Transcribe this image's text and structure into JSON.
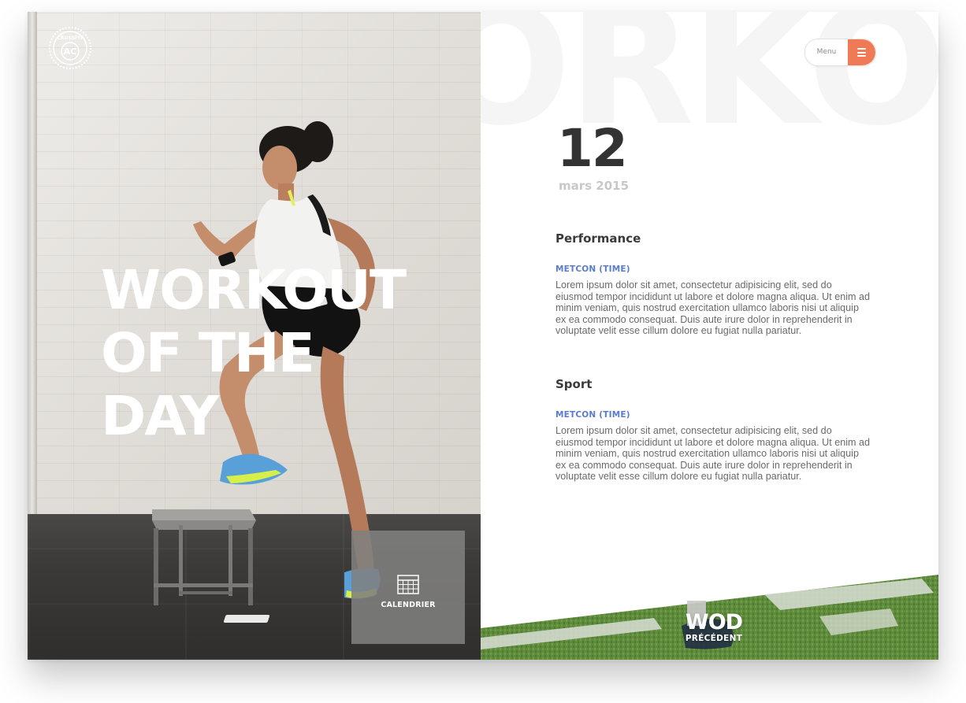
{
  "brand": {
    "logo_icon": "crossfit-ac-badge-icon",
    "logo_text": "AC",
    "logo_ring_text": "CROSSFIT"
  },
  "hero": {
    "title": "WORKOUT\nOF THE\nDAY",
    "calendar": {
      "icon": "calendar-icon",
      "label": "CALENDRIER"
    }
  },
  "header": {
    "background_word": "ORKO",
    "menu": {
      "label": "Menu",
      "icon": "hamburger-icon",
      "accent_color": "#f07a55"
    }
  },
  "date": {
    "day": "12",
    "month_year": "mars 2015"
  },
  "sections": [
    {
      "title": "Performance",
      "subtitle": "METCON (TIME)",
      "body": "Lorem ipsum dolor sit amet, consectetur adipisicing elit, sed do eiusmod tempor incididunt ut labore et dolore magna aliqua. Ut enim ad minim veniam, quis nostrud exercitation ullamco laboris nisi ut aliquip ex ea commodo consequat. Duis aute irure dolor in reprehenderit in voluptate velit esse cillum dolore eu fugiat nulla pariatur."
    },
    {
      "title": "Sport",
      "subtitle": "METCON (TIME)",
      "body": "Lorem ipsum dolor sit amet, consectetur adipisicing elit, sed do eiusmod tempor incididunt ut labore et dolore magna aliqua. Ut enim ad minim veniam, quis nostrud exercitation ullamco laboris nisi ut aliquip ex ea commodo consequat. Duis aute irure dolor in reprehenderit in voluptate velit esse cillum dolore eu fugiat nulla pariatur."
    }
  ],
  "footer": {
    "previous_wod": {
      "title": "WOD",
      "subtitle": "PRÉCÉDENT"
    }
  },
  "colors": {
    "accent": "#f07a55",
    "subtitle_blue": "#5a7ccc",
    "heading": "#3a3a3a",
    "body_text": "#6a6a6a",
    "turf_green": "#5e8a3a"
  }
}
